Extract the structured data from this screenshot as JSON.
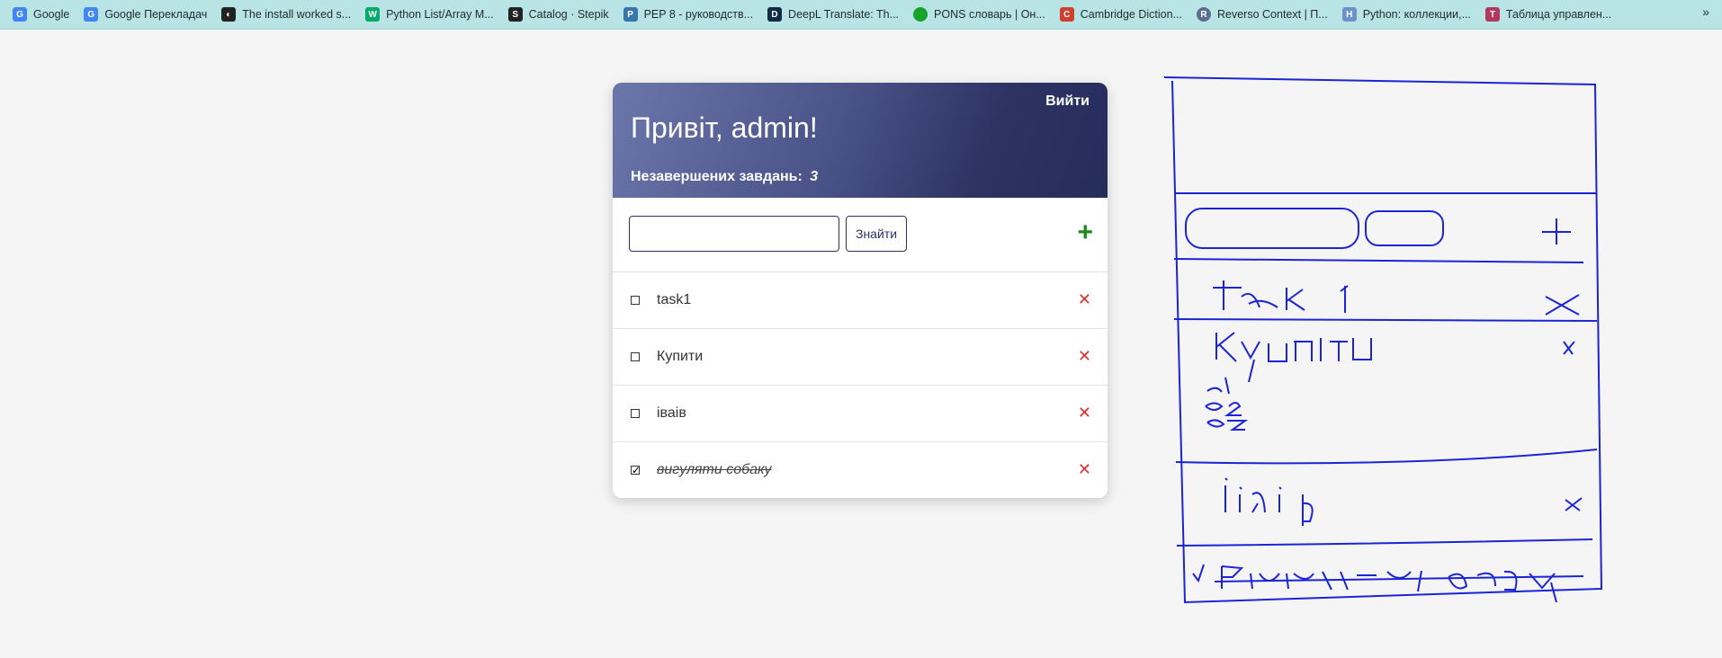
{
  "bookmarks": [
    {
      "label": "Google",
      "icon": "google-icon",
      "color": "#4285f4",
      "glyph": "G"
    },
    {
      "label": "Google Перекладач",
      "icon": "translate-icon",
      "color": "#4285f4",
      "glyph": "G"
    },
    {
      "label": "The install worked s...",
      "icon": "globe-icon",
      "color": "#222222",
      "glyph": "◐"
    },
    {
      "label": "Python List/Array M...",
      "icon": "w3schools-icon",
      "color": "#04aa6d",
      "glyph": "W"
    },
    {
      "label": "Catalog · Stepik",
      "icon": "stepik-icon",
      "color": "#222222",
      "glyph": "S"
    },
    {
      "label": "PEP 8 - руководств...",
      "icon": "python-icon",
      "color": "#3776ab",
      "glyph": "P"
    },
    {
      "label": "DeepL Translate: Th...",
      "icon": "deepl-icon",
      "color": "#0f2b46",
      "glyph": "D"
    },
    {
      "label": "PONS словарь | Он...",
      "icon": "pons-icon",
      "color": "#17a32a",
      "glyph": "●"
    },
    {
      "label": "Cambridge Diction...",
      "icon": "cambridge-icon",
      "color": "#d0402f",
      "glyph": "C"
    },
    {
      "label": "Reverso Context | П...",
      "icon": "reverso-icon",
      "color": "#5a6d8c",
      "glyph": "R"
    },
    {
      "label": "Python: коллекции,...",
      "icon": "hexlet-icon",
      "color": "#6c93c9",
      "glyph": "H"
    },
    {
      "label": "Таблица управлен...",
      "icon": "chem-icon",
      "color": "#b5375e",
      "glyph": "T"
    }
  ],
  "more_label": "»",
  "todo": {
    "logout": "Вийти",
    "greeting": "Привіт, admin!",
    "pending_label": "Незавершених завдань:",
    "pending_count": "3",
    "search_value": "",
    "search_button": "Знайти",
    "add_icon": "+",
    "tasks": [
      {
        "label": "task1",
        "done": false
      },
      {
        "label": "Купити",
        "done": false
      },
      {
        "label": "іваів",
        "done": false
      },
      {
        "label": "вигуляти собаку",
        "done": true
      }
    ],
    "delete_icon": "✕",
    "checkbox_checked": "✓"
  },
  "sketch": {
    "color": "#1b24d6",
    "lines": [
      "task 1",
      "Купити",
      "1",
      "2",
      "3",
      "іваів",
      "√",
      "вигуляти собаку",
      "+",
      "×"
    ]
  }
}
